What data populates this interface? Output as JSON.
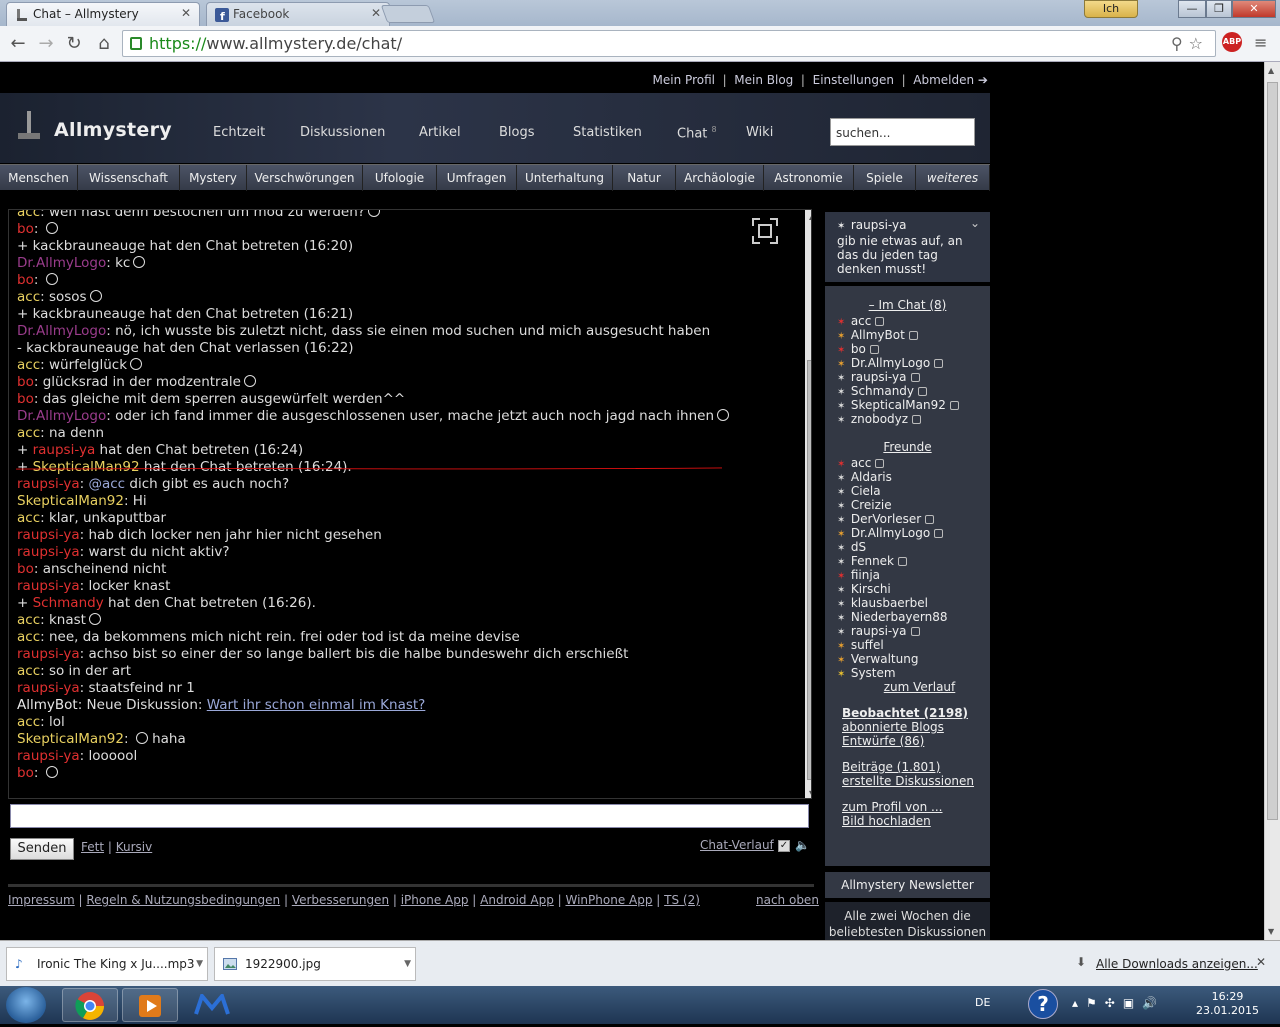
{
  "browser": {
    "tabs": [
      {
        "title": "Chat – Allmystery"
      },
      {
        "title": "Facebook"
      }
    ],
    "user_badge": "Ich",
    "url_scheme": "https://",
    "url_rest": "www.allmystery.de/chat/",
    "abp_label": "ABP"
  },
  "site": {
    "toplinks": [
      "Mein Profil",
      "Mein Blog",
      "Einstellungen",
      "Abmelden ➔"
    ],
    "logo": "Allmystery",
    "mainnav": [
      "Echtzeit",
      "Diskussionen",
      "Artikel",
      "Blogs",
      "Statistiken",
      "Chat",
      "Wiki"
    ],
    "chat_count": "8",
    "search_placeholder": "suchen...",
    "categories": [
      "Menschen",
      "Wissenschaft",
      "Mystery",
      "Verschwörungen",
      "Ufologie",
      "Umfragen",
      "Unterhaltung",
      "Natur",
      "Archäologie",
      "Astronomie",
      "Spiele",
      "weiteres"
    ]
  },
  "chat": {
    "lines": [
      {
        "name": "acc",
        "nc": "n-acc",
        "text": "wen hast denn bestochen um mod zu werden?",
        "smiley": true
      },
      {
        "name": "bo",
        "nc": "n-red",
        "text": "",
        "smiley": true
      },
      {
        "name": "",
        "nc": "",
        "text": "+ kackbrauneauge hat den Chat betreten (16:20)",
        "smiley": false
      },
      {
        "name": "Dr.AllmyLogo",
        "nc": "n-pur",
        "text": "kc",
        "smiley": true
      },
      {
        "name": "bo",
        "nc": "n-red",
        "text": "",
        "smiley": true
      },
      {
        "name": "acc",
        "nc": "n-acc",
        "text": "sosos",
        "smiley": true
      },
      {
        "name": "",
        "nc": "",
        "text": "+ kackbrauneauge hat den Chat betreten (16:21)",
        "smiley": false
      },
      {
        "name": "Dr.AllmyLogo",
        "nc": "n-pur",
        "text": "nö, ich wusste bis zuletzt nicht, dass sie einen mod suchen und mich ausgesucht haben",
        "smiley": false
      },
      {
        "name": "",
        "nc": "",
        "text": "- kackbrauneauge hat den Chat verlassen (16:22)",
        "smiley": false
      },
      {
        "name": "acc",
        "nc": "n-acc",
        "text": "würfelglück",
        "smiley": true
      },
      {
        "name": "bo",
        "nc": "n-red",
        "text": "glücksrad in der modzentrale",
        "smiley": true
      },
      {
        "name": "bo",
        "nc": "n-red",
        "text": "das gleiche mit dem sperren ausgewürfelt werden^^",
        "smiley": false
      },
      {
        "name": "Dr.AllmyLogo",
        "nc": "n-pur",
        "text": "oder ich fand immer die ausgeschlossenen user, mache jetzt auch noch jagd nach ihnen",
        "smiley": true
      },
      {
        "name": "acc",
        "nc": "n-acc",
        "text": "na denn",
        "smiley": false
      },
      {
        "name": "",
        "nc": "",
        "join": "raupsi-ya",
        "jc": "n-red",
        "text": "hat den Chat betreten (16:24)",
        "smiley": false
      },
      {
        "name": "",
        "nc": "",
        "join": "SkepticalMan92",
        "jc": "n-yel",
        "text": "hat den Chat betreten (16:24).",
        "smiley": false
      },
      {
        "name": "raupsi-ya",
        "nc": "n-red",
        "at": "@acc",
        "text": "dich gibt es auch noch?",
        "smiley": false
      },
      {
        "name": "SkepticalMan92",
        "nc": "n-yel",
        "text": "Hi",
        "smiley": false
      },
      {
        "name": "acc",
        "nc": "n-acc",
        "text": "klar, unkaputtbar",
        "smiley": false
      },
      {
        "name": "raupsi-ya",
        "nc": "n-red",
        "text": "hab dich locker nen jahr hier nicht gesehen",
        "smiley": false
      },
      {
        "name": "raupsi-ya",
        "nc": "n-red",
        "text": "warst du nicht aktiv?",
        "smiley": false
      },
      {
        "name": "bo",
        "nc": "n-red",
        "text": "anscheinend nicht",
        "smiley": false
      },
      {
        "name": "raupsi-ya",
        "nc": "n-red",
        "text": "locker knast",
        "smiley": false
      },
      {
        "name": "",
        "nc": "",
        "join": "Schmandy",
        "jc": "n-red",
        "text": "hat den Chat betreten (16:26).",
        "smiley": false
      },
      {
        "name": "acc",
        "nc": "n-acc",
        "text": "knast",
        "smiley": true
      },
      {
        "name": "acc",
        "nc": "n-acc",
        "text": "nee, da bekommens mich nicht rein. frei oder tod ist da meine devise",
        "smiley": false
      },
      {
        "name": "raupsi-ya",
        "nc": "n-red",
        "text": "achso bist so einer der so lange ballert bis die halbe bundeswehr dich erschießt",
        "smiley": false
      },
      {
        "name": "acc",
        "nc": "n-acc",
        "text": "so in der art",
        "smiley": false
      },
      {
        "name": "raupsi-ya",
        "nc": "n-red",
        "text": "staatsfeind nr 1",
        "smiley": false
      },
      {
        "name": "AllmyBot",
        "nc": "n-wht",
        "text": "Neue Diskussion:",
        "link": "Wart ihr schon einmal im Knast?",
        "smiley": false
      },
      {
        "name": "acc",
        "nc": "n-acc",
        "text": "lol",
        "smiley": false
      },
      {
        "name": "SkepticalMan92",
        "nc": "n-yel",
        "text": "haha",
        "smiley": true,
        "smiley_first": true
      },
      {
        "name": "raupsi-ya",
        "nc": "n-red",
        "text": "loooool",
        "smiley": false
      },
      {
        "name": "bo",
        "nc": "n-red",
        "text": "",
        "smiley": true
      }
    ],
    "send_label": "Senden",
    "bold_label": "Fett",
    "italic_label": "Kursiv",
    "history_label": "Chat-Verlauf"
  },
  "footer": {
    "links": [
      "Impressum",
      "Regeln & Nutzungsbedingungen",
      "Verbesserungen",
      "iPhone App",
      "Android App",
      "WinPhone App",
      "TS (2)"
    ],
    "top_link": "nach oben"
  },
  "sidebar": {
    "status_user": "raupsi-ya",
    "status_text": "gib nie etwas auf, an das du jeden tag denken musst!",
    "in_chat_heading": "–  Im Chat (8)",
    "in_chat": [
      {
        "name": "acc",
        "col": "#e03030",
        "cup": true
      },
      {
        "name": "AllmyBot",
        "col": "#e8a030",
        "cup": true
      },
      {
        "name": "bo",
        "col": "#e03030",
        "cup": true
      },
      {
        "name": "Dr.AllmyLogo",
        "col": "#e8a030",
        "cup": true
      },
      {
        "name": "raupsi-ya",
        "col": "#ddd",
        "cup": true
      },
      {
        "name": "Schmandy",
        "col": "#ddd",
        "cup": true
      },
      {
        "name": "SkepticalMan92",
        "col": "#ddd",
        "cup": true
      },
      {
        "name": "znobodyz",
        "col": "#ddd",
        "cup": true
      }
    ],
    "friends_heading": "Freunde",
    "friends": [
      {
        "name": "acc",
        "col": "#e03030",
        "cup": true
      },
      {
        "name": "Aldaris",
        "col": "#ddd",
        "cup": false
      },
      {
        "name": "Ciela",
        "col": "#ddd",
        "cup": false
      },
      {
        "name": "Creizie",
        "col": "#ddd",
        "cup": false
      },
      {
        "name": "DerVorleser",
        "col": "#ddd",
        "cup": true
      },
      {
        "name": "Dr.AllmyLogo",
        "col": "#e8a030",
        "cup": true
      },
      {
        "name": "dS",
        "col": "#ddd",
        "cup": false
      },
      {
        "name": "Fennek",
        "col": "#ddd",
        "cup": true
      },
      {
        "name": "fiinja",
        "col": "#e03030",
        "cup": false
      },
      {
        "name": "Kirschi",
        "col": "#ddd",
        "cup": false
      },
      {
        "name": "klausbaerbel",
        "col": "#ddd",
        "cup": false
      },
      {
        "name": "Niederbayern88",
        "col": "#ddd",
        "cup": false
      },
      {
        "name": "raupsi-ya",
        "col": "#ddd",
        "cup": true
      },
      {
        "name": "suffel",
        "col": "#e8a030",
        "cup": false
      },
      {
        "name": "Verwaltung",
        "col": "#e8a030",
        "cup": false
      },
      {
        "name": "System",
        "col": "#e8c030",
        "cup": false
      }
    ],
    "history_link": "zum Verlauf",
    "watched": "Beobachtet (2198)",
    "subscribed": "abonnierte Blogs",
    "drafts": "Entwürfe (86)",
    "posts": "Beiträge (1.801)",
    "created": "erstellte Diskussionen",
    "profile": "zum Profil von ...",
    "upload": "Bild hochladen",
    "newsletter_title": "Allmystery Newsletter",
    "newsletter_text": "Alle zwei Wochen die beliebtesten Diskussionen"
  },
  "downloads": {
    "items": [
      "Ironic The King x Ju....mp3",
      "1922900.jpg"
    ],
    "all_label": "Alle Downloads anzeigen..."
  },
  "taskbar": {
    "lang": "DE",
    "time": "16:29",
    "date": "23.01.2015"
  }
}
